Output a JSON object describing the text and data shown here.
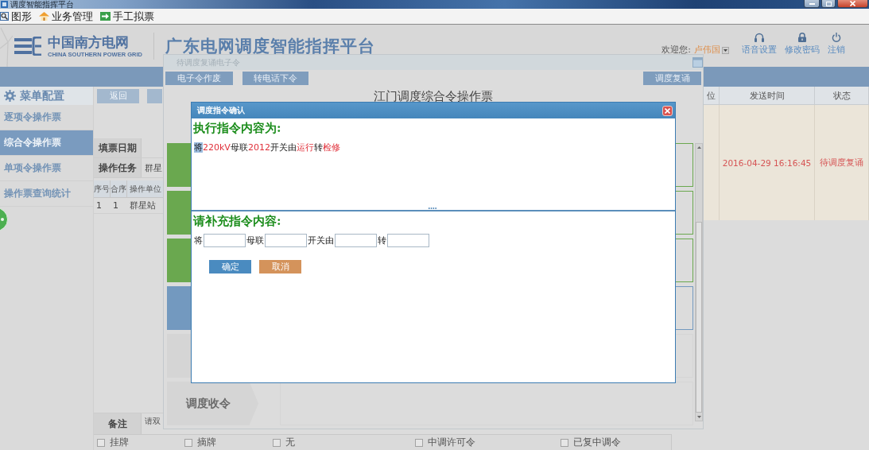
{
  "window": {
    "title": "调度智能指挥平台"
  },
  "menu_bar": [
    {
      "label": "图形"
    },
    {
      "label": "业务管理"
    },
    {
      "label": "手工拟票"
    }
  ],
  "header": {
    "logo": "中国南方电网",
    "logo_subtitle": "CHINA SOUTHERN POWER GRID",
    "title": "广东电网调度智能指挥平台",
    "welcome": "欢迎您:",
    "user": "卢伟国",
    "actions": [
      {
        "label": "语音设置"
      },
      {
        "label": "修改密码"
      },
      {
        "label": "注销"
      }
    ]
  },
  "sidebar": {
    "title": "菜单配置",
    "items": [
      {
        "label": "逐项令操作票",
        "selected": false
      },
      {
        "label": "综合令操作票",
        "selected": true
      },
      {
        "label": "单项令操作票",
        "selected": false
      },
      {
        "label": "操作票查询统计",
        "selected": false
      }
    ]
  },
  "ticket_form": {
    "back_button": "返回",
    "fields": [
      {
        "label": "填票日期"
      },
      {
        "label": "操作任务",
        "value": "群星"
      }
    ],
    "table": {
      "columns": [
        "序号",
        "合序",
        "操作单位"
      ],
      "rows": [
        [
          "1",
          "1",
          "群星站"
        ]
      ]
    },
    "remarks": {
      "label": "备注",
      "value": "请双"
    },
    "checkboxes": [
      {
        "label": "挂牌",
        "checked": false
      },
      {
        "label": "摘牌",
        "checked": false
      },
      {
        "label": "无",
        "checked": false
      },
      {
        "label": "中调许可令",
        "checked": false
      },
      {
        "label": "已复中调令",
        "checked": false
      }
    ]
  },
  "message_table": {
    "columns": [
      "位",
      "发送时间",
      "状态"
    ],
    "rows": [
      {
        "send_time": "2016-04-29 16:16:45",
        "status": "待调度复诵"
      }
    ]
  },
  "panel": {
    "title": "待调度复诵电子令",
    "left_buttons": [
      "电子令作废",
      "转电话下令"
    ],
    "right_buttons": [
      "调度复诵"
    ],
    "heading": "江门调度综合令操作票",
    "steps": [
      {
        "color": "#6aa84f"
      },
      {
        "color": "#6aa84f"
      },
      {
        "color": "#6aa84f"
      },
      {
        "color": "#7399bf"
      },
      {
        "color": "#d5d5d5"
      },
      {
        "color": "#d5d5d5",
        "label": "调度收令"
      }
    ]
  },
  "dialog": {
    "title": "调度指令确认",
    "execute_heading": "执行指令内容为:",
    "instruction": [
      {
        "text": "将",
        "emphasis": false,
        "selected": true
      },
      {
        "text": "220kV",
        "emphasis": true,
        "selected": false
      },
      {
        "text": "母联",
        "emphasis": false,
        "selected": false
      },
      {
        "text": "2012",
        "emphasis": true,
        "selected": false
      },
      {
        "text": "开关由",
        "emphasis": false,
        "selected": false
      },
      {
        "text": "运行",
        "emphasis": true,
        "selected": false
      },
      {
        "text": "转",
        "emphasis": false,
        "selected": false
      },
      {
        "text": "检修",
        "emphasis": true,
        "selected": false
      }
    ],
    "supplement_heading": "请补充指令内容:",
    "fields": [
      {
        "label": "将"
      },
      {
        "label": "母联"
      },
      {
        "label": "开关由"
      },
      {
        "label": "转"
      }
    ],
    "buttons": [
      {
        "label": "确定",
        "kind": "primary"
      },
      {
        "label": "取消",
        "kind": "cancel"
      }
    ]
  }
}
